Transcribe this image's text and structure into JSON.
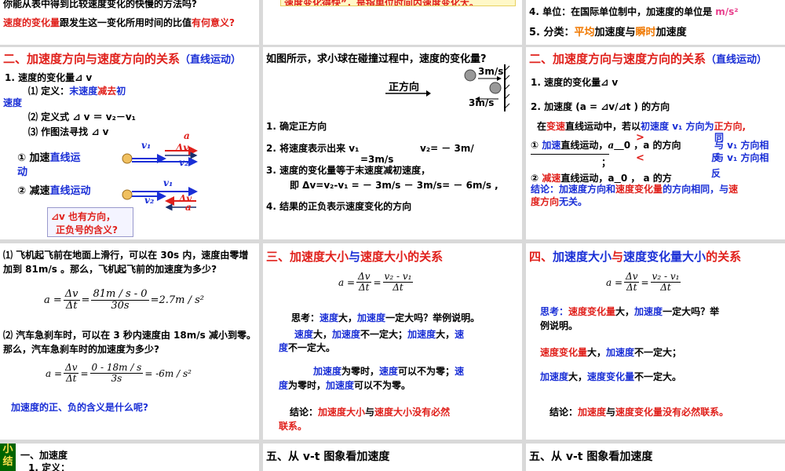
{
  "p1": {
    "line1": "你能从表中得到比较速度变化的快慢的方法吗?",
    "line2a": "速度的变化量",
    "line2b": "跟发生这一变化所用时间的比值",
    "line2c": "有何意义?"
  },
  "p2": {
    "banner": "速度变化得快”，是指单位时间内速度变化大。"
  },
  "p3": {
    "item4a": "4. 单位：在国际单位制中，加速度的单位是 ",
    "item4b": "m/s²",
    "item5a": "5. 分类：",
    "item5b": "平均",
    "item5c": "加速度与",
    "item5d": "瞬时",
    "item5e": "加速度"
  },
  "p4": {
    "title_a": "二、加速度方向与速度方向的关系",
    "title_b": "（直线运动）",
    "l1": "1. 速度的变化量⊿ v",
    "l2a": "⑴ 定义：",
    "l2b": "末速度",
    "l2c": "减去",
    "l2d": "初",
    "l2e": "速度",
    "l3": "⑵ 定义式 ⊿ v ＝ v₂－v₁",
    "l4": "⑶ 作图法寻找 ⊿ v",
    "case1a": "① 加速",
    "case1b": "直线运",
    "case1c": "动",
    "case2a": "② 减速",
    "case2b": "直线运动",
    "v1": "v₁",
    "v2": "v₂",
    "dv": "Δv",
    "a": "a",
    "question_a": "⊿v 也有方向，",
    "question_b": "正负号的含义?"
  },
  "p5": {
    "title": "如图所示，求小球在碰撞过程中，速度的变化量?",
    "dir_label": "正方向",
    "speed1": "3m/s",
    "speed2": "3m/s",
    "s1": "1. 确定正方向",
    "s2a": "2. 将速度表示出来 v₁",
    "s2b": "v₂= － 3m/",
    "s2c": "=3m/s",
    "s3a": "3. 速度的变化量等于末速度减初速度，",
    "s3b": "即 Δv=v₂-v₁ = － 3m/s － 3m/s= － 6m/s ,",
    "s4": "4. 结果的正负表示速度变化的方向"
  },
  "p6": {
    "title_a": "二、加速度方向与速度方向的关系",
    "title_b": "（直线运动）",
    "l1": "1. 速度的变化量⊿ v",
    "l2": "2. 加速度  (a = ⊿v/⊿t ) 的方向",
    "l3a": "在",
    "l3b": "变速",
    "l3c": "直线运动中，若以",
    "l3d": "初速度 v₁ 方向为",
    "l3e": "正方向,",
    "c1a": "① ",
    "c1b": "加速",
    "c1c": "直线运动，",
    "c1d": "a",
    "c1e": "0 ，a 的方向",
    "c1f": "与 v₁ 方向相",
    "c1g": "；",
    "c2a": "② ",
    "c2b": "减速",
    "c2c": "直线运动，a",
    "c2d": "0 ， a 的方",
    "c2e": "与 v₁ 方向相",
    "gt": ">",
    "lt": "<",
    "tong": "同",
    "fan": "反",
    "concl_a": "结论：",
    "concl_b": "加速度方向",
    "concl_c": "和",
    "concl_d": "速度变化量",
    "concl_e": "的方向相同，与",
    "concl_f": "速",
    "concl_g": "度方向",
    "concl_h": "无关。"
  },
  "p7": {
    "q1": "⑴ 飞机起飞前在地面上滑行，可以在 30s 内，速度由零增加到 81m/s 。那么，飞机起飞前的加速度为多少?",
    "f1_lhs": "a",
    "f1_dv": "Δv",
    "f1_dt": "Δt",
    "f1_num": "81m / s - 0",
    "f1_den": "30s",
    "f1_res": "=2.7m / s²",
    "q2": "⑵ 汽车急刹车时，可以在 3 秒内速度由 18m/s 减小到零。那么，汽车急刹车时的加速度为多少?",
    "f2_num": "0 - 18m / s",
    "f2_den": "3s",
    "f2_res": "= -6m / s²",
    "q3": "加速度的正、负的含义是什么呢?"
  },
  "p8": {
    "title_a": "三、",
    "title_b": "加速度大小",
    "title_c": "与",
    "title_d": "速度大小",
    "title_e": "的关系",
    "f_lhs": "a",
    "f_num1": "Δv",
    "f_den1": "Δt",
    "f_num2": "v₂ - v₁",
    "f_den2": "Δt",
    "think_a": "思考：",
    "think_b": "速度",
    "think_c": "大，",
    "think_d": "加速度",
    "think_e": "一定大吗？举例说明。",
    "r1a": "速度",
    "r1b": "大，",
    "r1c": "加速度",
    "r1d": "不一定大；",
    "r1e": "加速度",
    "r1f": "大，",
    "r1g": "速",
    "r1h": "度",
    "r1i": "不一定大。",
    "r2a": "加速度",
    "r2b": "为零时，",
    "r2c": "速度",
    "r2d": "可以不为零；",
    "r2e": "速",
    "r2f": "度",
    "r2g": "为零时，",
    "r2h": "加速度",
    "r2i": "可以不为零。",
    "concl_a": "结论：",
    "concl_b": "加速度大小",
    "concl_c": "与",
    "concl_d": "速度大小",
    "concl_e": "没有必然",
    "concl_f": "联系。"
  },
  "p9": {
    "title_a": "四、",
    "title_b": "加速度大小",
    "title_c": "与",
    "title_d": "速度变化量大小",
    "title_e": "的关系",
    "think_a": "思考：",
    "think_b": "速度变化量",
    "think_c": "大，",
    "think_d": "加速度",
    "think_e": "一定大吗？举",
    "think_f": "例说明。",
    "r1a": "速度变化量",
    "r1b": "大，",
    "r1c": "加速度",
    "r1d": "不一定大；",
    "r2a": "加速度",
    "r2b": "大，",
    "r2c": "速度变化量",
    "r2d": "不一定大。",
    "concl_a": "结论：",
    "concl_b": "加速度",
    "concl_c": "与",
    "concl_d": "速度变化量",
    "concl_e": "没有必然联系。"
  },
  "p10": {
    "side_a": "小",
    "side_b": "结",
    "l1": "一、加速度",
    "l2": "1. 定义："
  },
  "p11": {
    "title": "五、从 v-t  图象看加速度"
  },
  "p12": {
    "title": "五、从 v-t  图象看加速度"
  },
  "colors": {
    "red": "#e0201b",
    "blue": "#1a2fd6",
    "orange": "#f07800",
    "green_nav": "#00a000",
    "nav_bg": "#ffe14d"
  }
}
